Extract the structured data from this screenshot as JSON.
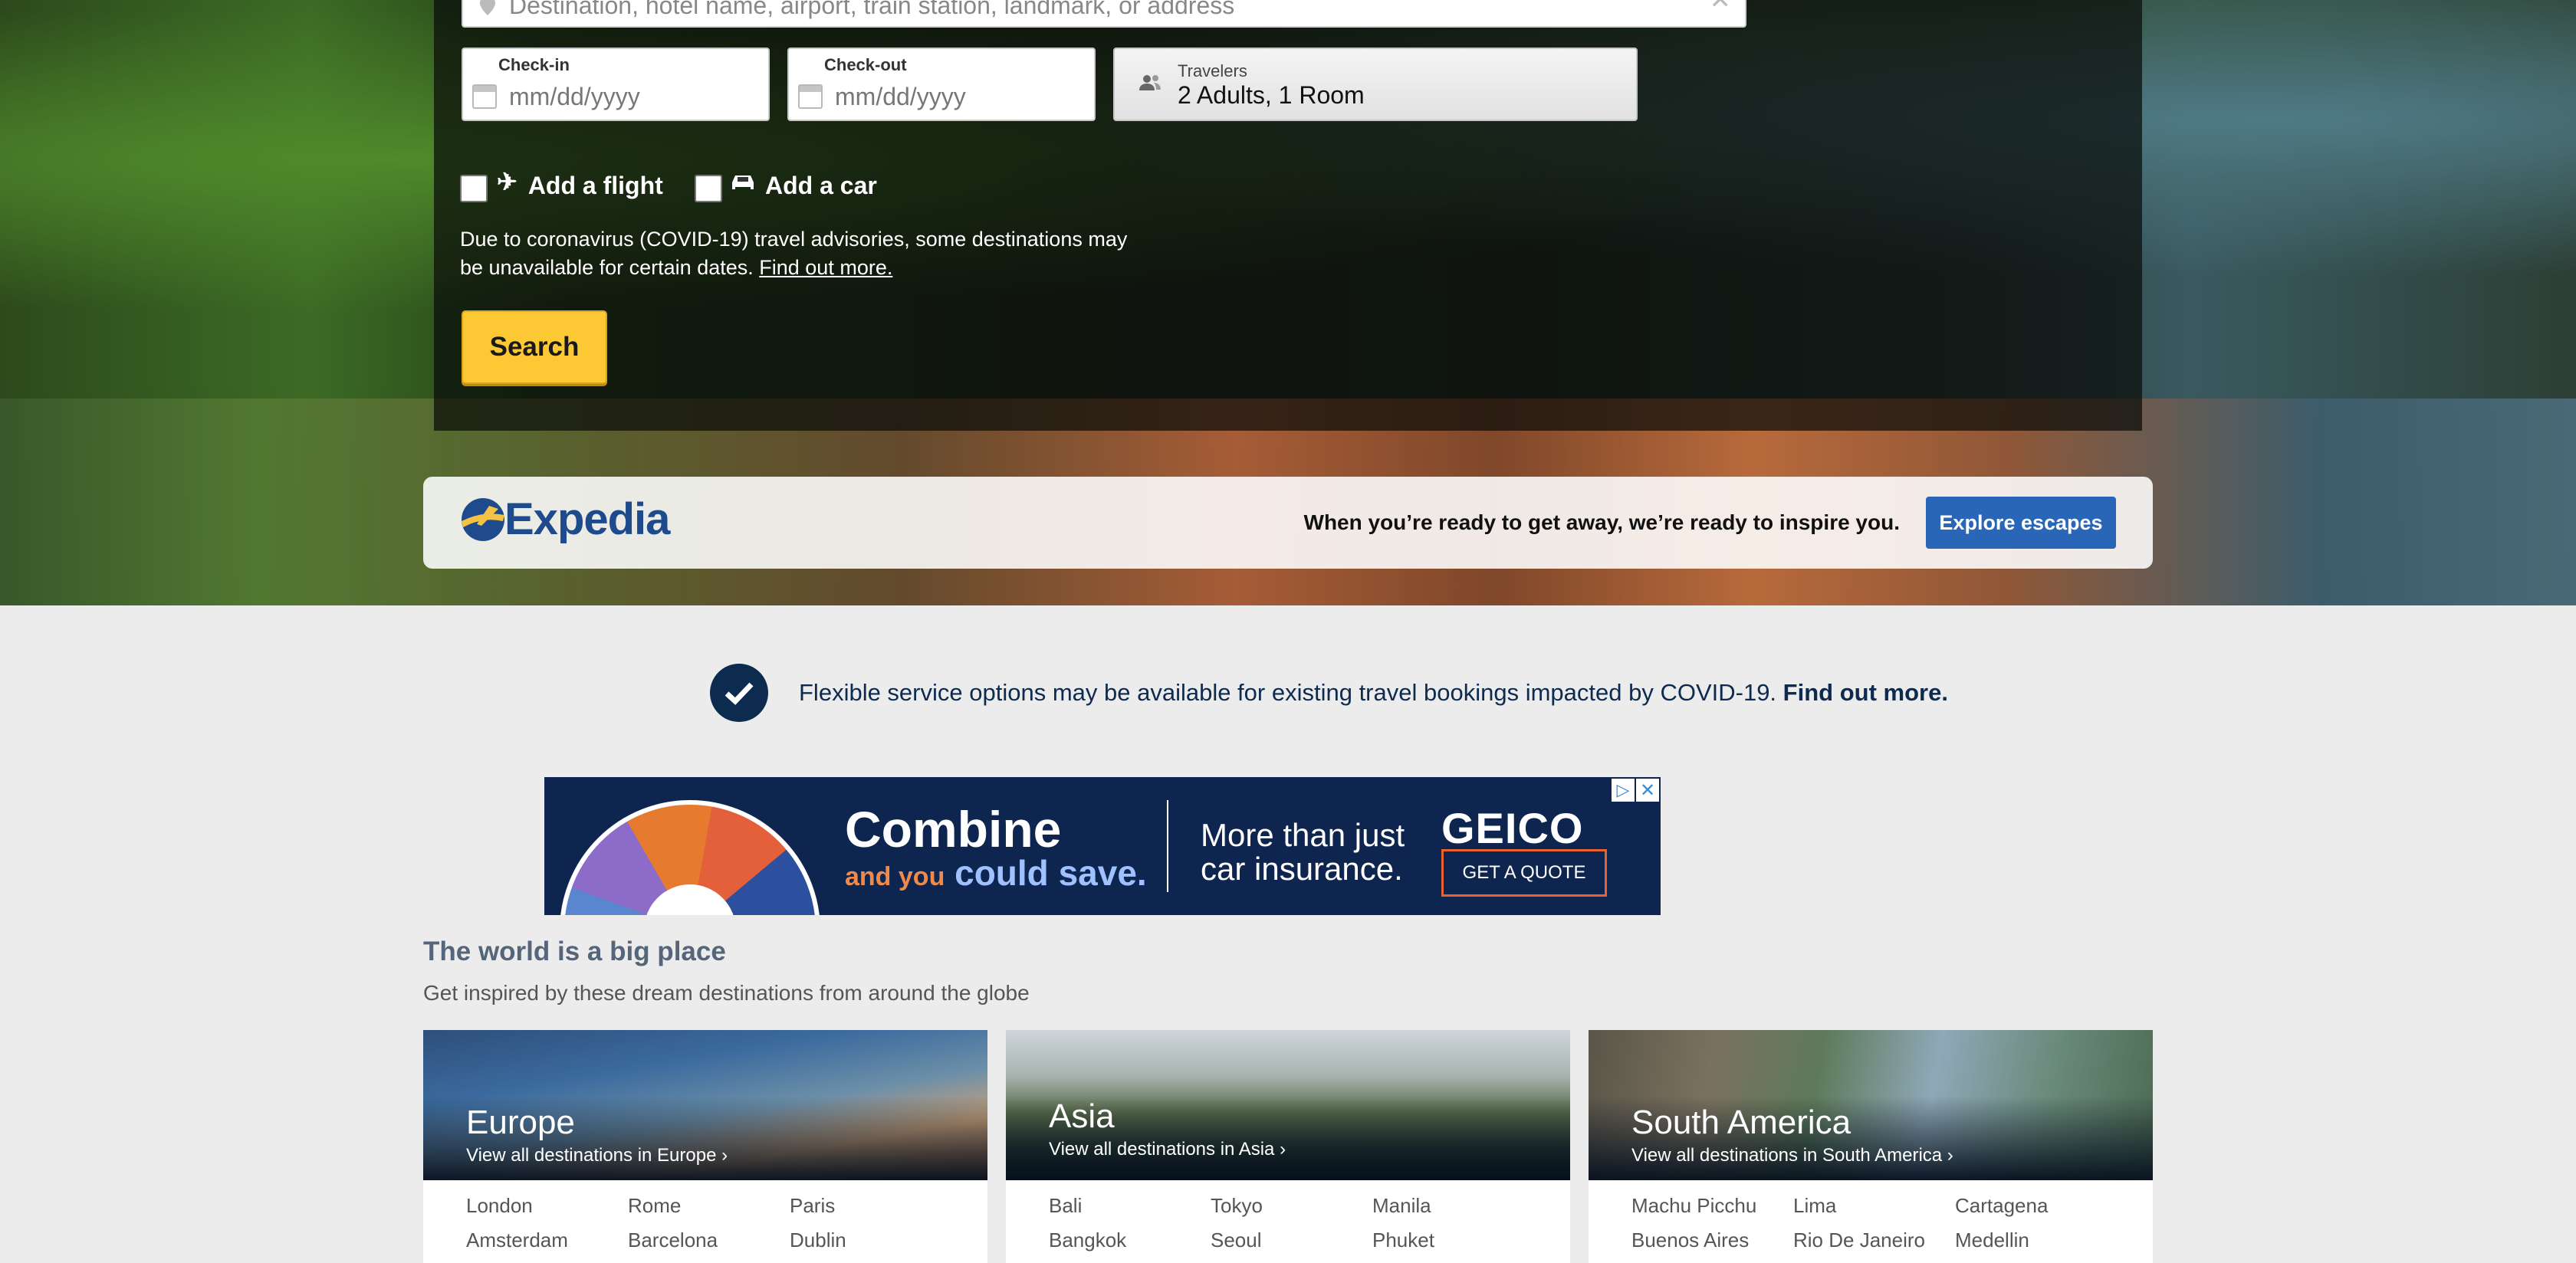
{
  "search": {
    "destination_placeholder": "Destination, hotel name, airport, train station, landmark, or address",
    "checkin_label": "Check-in",
    "checkin_placeholder": "mm/dd/yyyy",
    "checkout_label": "Check-out",
    "checkout_placeholder": "mm/dd/yyyy",
    "travelers_label": "Travelers",
    "travelers_value": "2 Adults, 1 Room",
    "add_flight": "Add a flight",
    "add_car": "Add a car",
    "covid_note": "Due to coronavirus (COVID-19) travel advisories, some destinations may be unavailable for certain dates.",
    "covid_link": "Find out more.",
    "search_button": "Search"
  },
  "expedia": {
    "logo_text": "Expedia",
    "tagline": "When you’re ready to get away, we’re ready to inspire you.",
    "explore_button": "Explore escapes"
  },
  "flex_notice": {
    "text": "Flexible service options may be available for existing travel bookings impacted by COVID-19.",
    "link": "Find out more."
  },
  "ad": {
    "headline": "Combine",
    "subline_small": "and you",
    "subline_big": "could save.",
    "right_text_line1": "More than just",
    "right_text_line2": "car insurance.",
    "brand": "GEICO",
    "cta": "GET A QUOTE"
  },
  "world": {
    "title": "The world is a big place",
    "subtitle": "Get inspired by these dream destinations from around the globe",
    "regions": [
      {
        "name": "Europe",
        "link": "View all destinations in Europe",
        "cities": [
          "London",
          "Rome",
          "Paris",
          "Amsterdam",
          "Barcelona",
          "Dublin"
        ]
      },
      {
        "name": "Asia",
        "link": "View all destinations in Asia",
        "cities": [
          "Bali",
          "Tokyo",
          "Manila",
          "Bangkok",
          "Seoul",
          "Phuket"
        ]
      },
      {
        "name": "South America",
        "link": "View all destinations in South America",
        "cities": [
          "Machu Picchu",
          "Lima",
          "Cartagena",
          "Buenos Aires",
          "Rio De Janeiro",
          "Medellin"
        ]
      }
    ]
  },
  "colors": {
    "search_button": "#fcc934",
    "explore_button": "#2a66b8",
    "navy": "#0d2a4f"
  }
}
